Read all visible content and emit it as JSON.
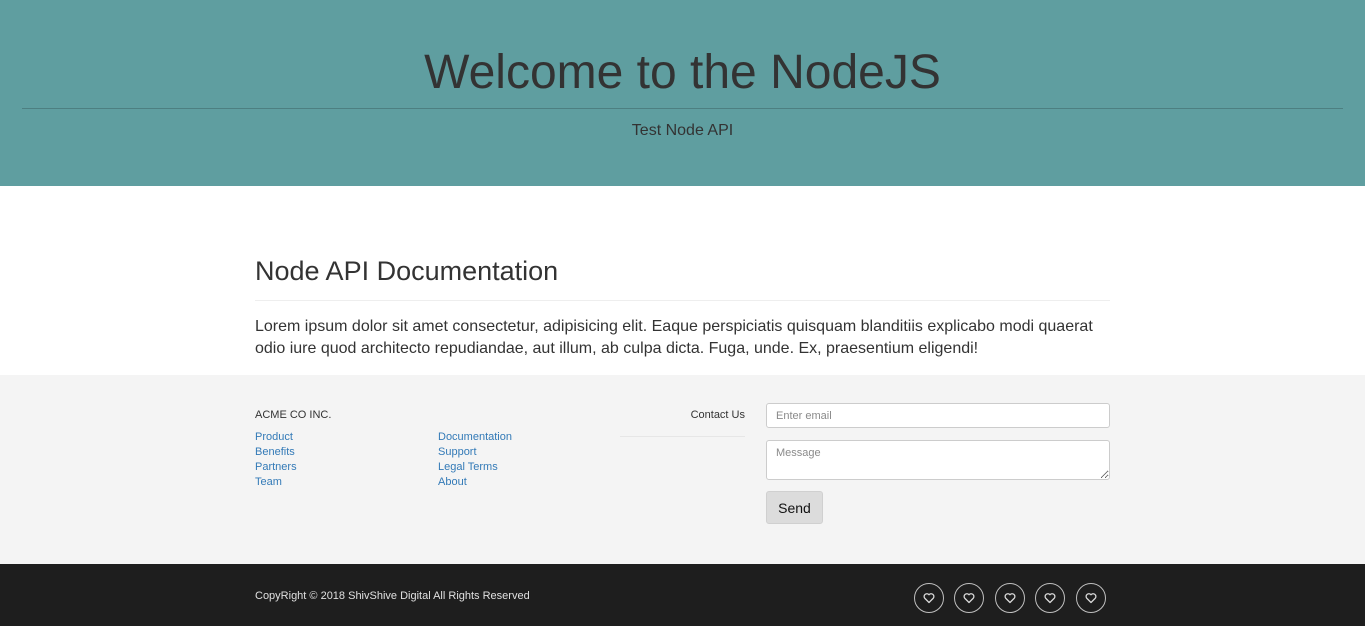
{
  "hero": {
    "title": "Welcome to the NodeJS",
    "subtitle": "Test Node API",
    "background_color": "#5f9ea0"
  },
  "main": {
    "heading": "Node API Documentation",
    "body": "Lorem ipsum dolor sit amet consectetur, adipisicing elit. Eaque perspiciatis quisquam blanditiis explicabo modi quaerat odio iure quod architecto repudiandae, aut illum, ab culpa dicta. Fuga, unde. Ex, praesentium eligendi!"
  },
  "footer": {
    "company": "ACME CO INC.",
    "links_col1": [
      "Product",
      "Benefits",
      "Partners",
      "Team"
    ],
    "links_col2": [
      "Documentation",
      "Support",
      "Legal Terms",
      "About"
    ],
    "link_color": "#337ab7",
    "contact_label": "Contact Us",
    "email_placeholder": "Enter email",
    "message_placeholder": "Message",
    "send_label": "Send"
  },
  "bottom_bar": {
    "copyright": "CopyRight © 2018 ShivShive Digital All Rights Reserved",
    "social_icons": [
      "heart-icon",
      "heart-icon",
      "heart-icon",
      "heart-icon",
      "heart-icon"
    ],
    "background_color": "#1e1e1e"
  }
}
